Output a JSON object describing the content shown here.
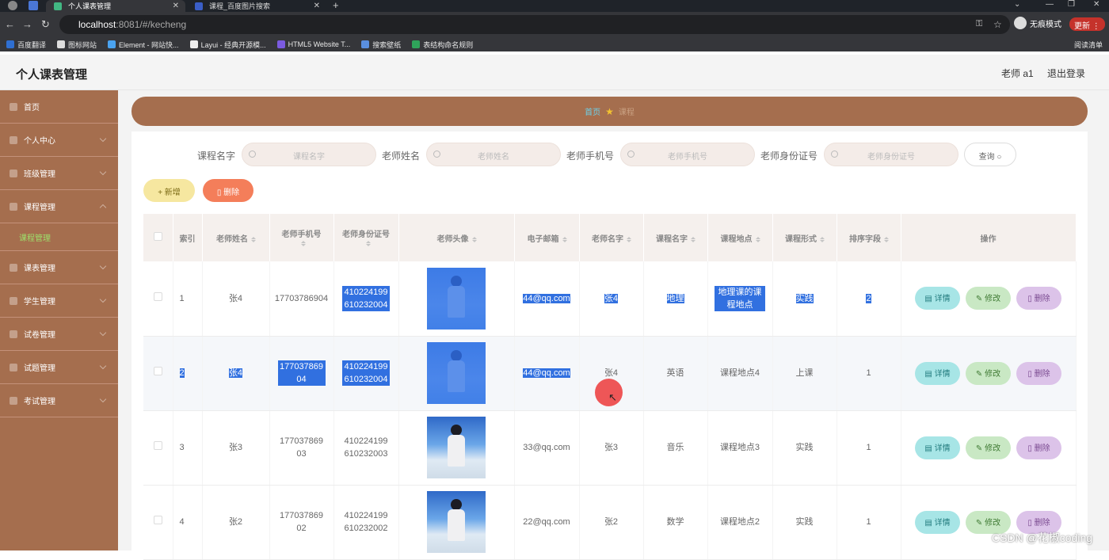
{
  "browser": {
    "tabs": [
      {
        "title": "个人课表管理",
        "active": true
      },
      {
        "title": "课程_百度图片搜索",
        "active": false
      }
    ],
    "url": {
      "host": "localhost",
      "path": ":8081/#/kecheng"
    },
    "incognito_label": "无痕模式",
    "update_label": "更新",
    "bookmarks": [
      "百度翻译",
      "图标网站",
      "Element - 网站快...",
      "Layui - 经典开源模...",
      "HTML5 Website T...",
      "搜索壁纸",
      "表结构命名规则"
    ],
    "reading_list": "阅读清单"
  },
  "header": {
    "title": "个人课表管理",
    "user": "老师 a1",
    "logout": "退出登录"
  },
  "sidebar": {
    "items": [
      {
        "label": "首页"
      },
      {
        "label": "个人中心"
      },
      {
        "label": "班级管理"
      },
      {
        "label": "课程管理"
      },
      {
        "label": "课程管理",
        "sub": true
      },
      {
        "label": "课表管理"
      },
      {
        "label": "学生管理"
      },
      {
        "label": "试卷管理"
      },
      {
        "label": "试题管理"
      },
      {
        "label": "考试管理"
      }
    ]
  },
  "breadcrumb": {
    "home": "首页",
    "current": "课程"
  },
  "search": {
    "fields": [
      {
        "label": "课程名字",
        "placeholder": "课程名字"
      },
      {
        "label": "老师姓名",
        "placeholder": "老师姓名"
      },
      {
        "label": "老师手机号",
        "placeholder": "老师手机号"
      },
      {
        "label": "老师身份证号",
        "placeholder": "老师身份证号"
      }
    ],
    "query_label": "查询"
  },
  "toolbar": {
    "add_label": "+ 新增",
    "delete_label": "删除"
  },
  "table": {
    "columns": [
      "索引",
      "老师姓名",
      "老师手机号",
      "老师身份证号",
      "老师头像",
      "电子邮箱",
      "老师名字",
      "课程名字",
      "课程地点",
      "课程形式",
      "排序字段",
      "操作"
    ],
    "rows": [
      {
        "index": "1",
        "teacher_name": "张4",
        "phone": "17703786904",
        "id_card": "410224199610232004",
        "email": "44@qq.com",
        "name": "张4",
        "course": "地理",
        "location": "地理课的课程地点",
        "form": "实践",
        "sort": "2"
      },
      {
        "index": "2",
        "teacher_name": "张4",
        "phone": "17703786904",
        "id_card": "410224199610232004",
        "email": "44@qq.com",
        "name": "张4",
        "course": "英语",
        "location": "课程地点4",
        "form": "上课",
        "sort": "1"
      },
      {
        "index": "3",
        "teacher_name": "张3",
        "phone": "17703786903",
        "id_card": "410224199610232003",
        "email": "33@qq.com",
        "name": "张3",
        "course": "音乐",
        "location": "课程地点3",
        "form": "实践",
        "sort": "1"
      },
      {
        "index": "4",
        "teacher_name": "张2",
        "phone": "17703786902",
        "id_card": "410224199610232002",
        "email": "22@qq.com",
        "name": "张2",
        "course": "数学",
        "location": "课程地点2",
        "form": "实践",
        "sort": "1"
      }
    ],
    "actions": {
      "detail": "详情",
      "edit": "修改",
      "remove": "删除"
    }
  },
  "watermark": "CSDN @花椒coding"
}
